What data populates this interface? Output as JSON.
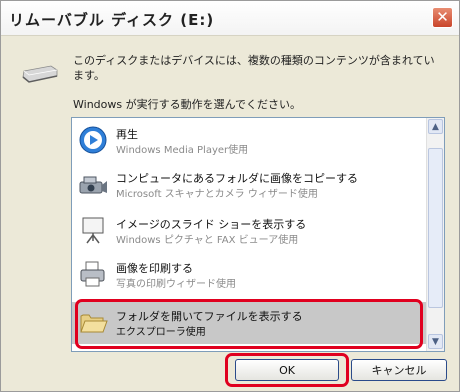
{
  "window": {
    "title": "リムーバブル ディスク (E:)",
    "close_glyph": "✕"
  },
  "message": "このディスクまたはデバイスには、複数の種類のコンテンツが含まれています。",
  "instruction": "Windows が実行する動作を選んでください。",
  "actions": [
    {
      "label": "再生",
      "sub": "Windows Media Player使用",
      "icon": "media-player-icon",
      "selected": false
    },
    {
      "label": "コンピュータにあるフォルダに画像をコピーする",
      "sub": "Microsoft スキャナとカメラ ウィザード使用",
      "icon": "camera-scanner-icon",
      "selected": false
    },
    {
      "label": "イメージのスライド ショーを表示する",
      "sub": "Windows ピクチャと FAX ビューア使用",
      "icon": "slideshow-icon",
      "selected": false
    },
    {
      "label": "画像を印刷する",
      "sub": "写真の印刷ウィザード使用",
      "icon": "printer-icon",
      "selected": false
    },
    {
      "label": "フォルダを開いてファイルを表示する",
      "sub": "エクスプローラ使用",
      "icon": "folder-icon",
      "selected": true
    }
  ],
  "buttons": {
    "ok": "OK",
    "cancel": "キャンセル"
  },
  "colors": {
    "highlight_outline": "#e0001f",
    "selection": "#c8c8c8",
    "dialog_bg": "#ece9d8"
  }
}
